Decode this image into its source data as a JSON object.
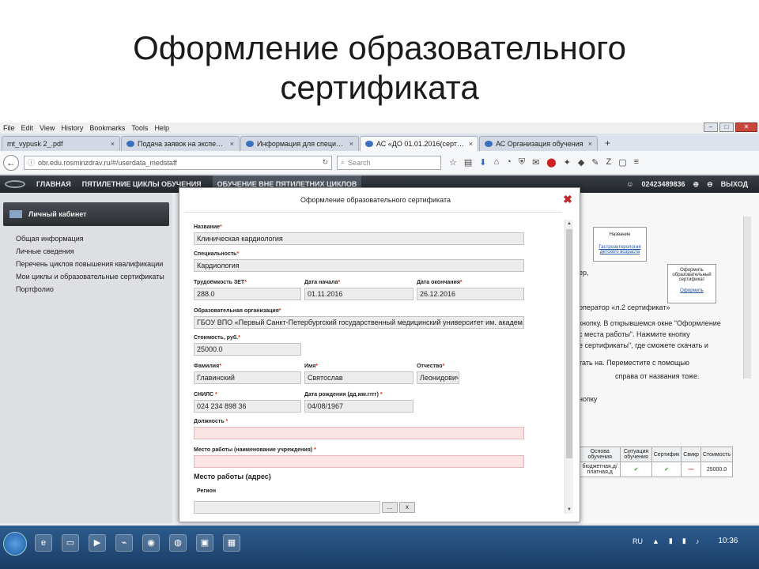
{
  "slide": {
    "title_line1": "Оформление образовательного",
    "title_line2": "сертификата"
  },
  "browser": {
    "menu": [
      "File",
      "Edit",
      "View",
      "History",
      "Bookmarks",
      "Tools",
      "Help"
    ],
    "tabs": [
      {
        "label": "mt_vypusk 2_.pdf",
        "active": false
      },
      {
        "label": "Подача заявок на экспертизу",
        "active": false
      },
      {
        "label": "Информация для специалистов",
        "active": false
      },
      {
        "label": "АС «ДО 01.01.2016(сертификат)»",
        "active": true
      },
      {
        "label": "АС Организация обучения",
        "active": false
      }
    ],
    "url": "obr.edu.rosminzdrav.ru/#/userdata_medstaff",
    "search_placeholder": "Search"
  },
  "site": {
    "nav_home": "ГЛАВНАЯ",
    "nav_cycles": "ПЯТИЛЕТНИЕ ЦИКЛЫ ОБУЧЕНИЯ",
    "nav_other": "ОБУЧЕНИЕ ВНЕ ПЯТИЛЕТНИХ ЦИКЛОВ",
    "user_id": "02423489836",
    "logout": "ВЫХОД"
  },
  "sidebar": {
    "header": "Личный кабинет",
    "links": [
      "Общая информация",
      "Личные сведения",
      "Перечень циклов повышения квалификации",
      "Мои циклы и образовательные сертификаты",
      "Портфолио"
    ]
  },
  "background_page": {
    "box1_title": "Название",
    "box1_link": "Гастроэнтерология детского возраста",
    "box2_title": "Оформить образовательный сертификат",
    "box2_link": "Оформить",
    "text1": "ер,",
    "text2": "оператор «л.2 сертификат»",
    "text3": "кнопку. В открывшемся окне \"Оформление",
    "text4": "с места работы\". Нажмите кнопку",
    "text5": "е сертификаты\", где сможете скачать и",
    "text6": "тать на. Переместите с помощью",
    "text7": "справа от названия тоже.",
    "text8": "нопку",
    "table_headers": [
      "Основа обучения",
      "Ситуация обучения",
      "Сертифик",
      "Свикр",
      "Стоимость"
    ],
    "table_row": [
      "бюджетная,д/платная,д",
      "✔",
      "✔",
      "—",
      "25000.0"
    ]
  },
  "modal": {
    "title": "Оформление образовательного сертификата",
    "fields": {
      "name_label": "Название",
      "name_value": "Клиническая кардиология",
      "specialty_label": "Специальность",
      "specialty_value": "Кардиология",
      "hours_label": "Трудоёмкость ЗЕТ",
      "hours_value": "288.0",
      "start_label": "Дата начала",
      "start_value": "01.11.2016",
      "end_label": "Дата окончания",
      "end_value": "26.12.2016",
      "org_label": "Образовательная организация",
      "org_value": "ГБОУ ВПО «Первый Санкт-Петербургский государственный медицинский университет им. академ. И",
      "cost_label": "Стоимость, руб.",
      "cost_value": "25000.0",
      "surname_label": "Фамилия",
      "surname_value": "Главинский",
      "firstname_label": "Имя",
      "firstname_value": "Святослав",
      "patronymic_label": "Отчество",
      "patronymic_value": "Леонидович",
      "snils_label": "СНИЛС",
      "snils_value": "024 234 898 36",
      "birth_label": "Дата рождения (дд.мм.гггг)",
      "birth_value": "04/08/1967",
      "position_label": "Должность",
      "position_value": "",
      "workplace_label": "Место работы (наименование учреждения)",
      "workplace_value": "",
      "address_section": "Место работы (адрес)",
      "region_label": "Регион",
      "btn_browse": "...",
      "btn_clear": "x"
    }
  },
  "taskbar": {
    "lang": "RU",
    "time": "10:36"
  }
}
